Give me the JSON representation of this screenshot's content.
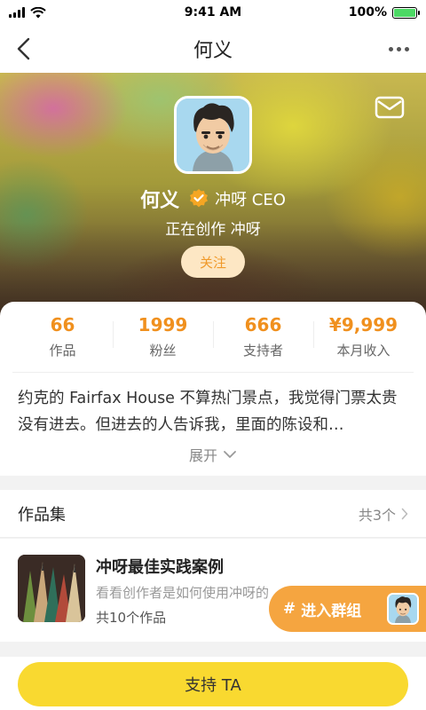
{
  "status_bar": {
    "time": "9:41 AM",
    "battery": "100%",
    "battery_level": 1.0
  },
  "nav": {
    "title": "何义"
  },
  "profile": {
    "name": "何义",
    "role": "冲呀 CEO",
    "status": "正在创作 冲呀",
    "follow_label": "关注"
  },
  "stats": [
    {
      "value": "66",
      "label": "作品"
    },
    {
      "value": "1999",
      "label": "粉丝"
    },
    {
      "value": "666",
      "label": "支持者"
    },
    {
      "value": "¥9,999",
      "label": "本月收入"
    }
  ],
  "bio": "约克的 Fairfax House 不算热门景点，我觉得门票太贵没有进去。但进去的人告诉我，里面的陈设和…",
  "expand_label": "展开",
  "collections_section": {
    "title": "作品集",
    "count": "共3个"
  },
  "collection": {
    "title": "冲呀最佳实践案例",
    "description": "看看创作者是如何使用冲呀的",
    "count": "共10个作品"
  },
  "group_button": {
    "hash": "#",
    "label": "进入群组"
  },
  "support_button": {
    "label": "支持 TA"
  },
  "colors": {
    "accent": "#f0901e",
    "support_yellow": "#f9d930",
    "group_orange": "#f5a540",
    "verify_orange": "#f5a623"
  }
}
